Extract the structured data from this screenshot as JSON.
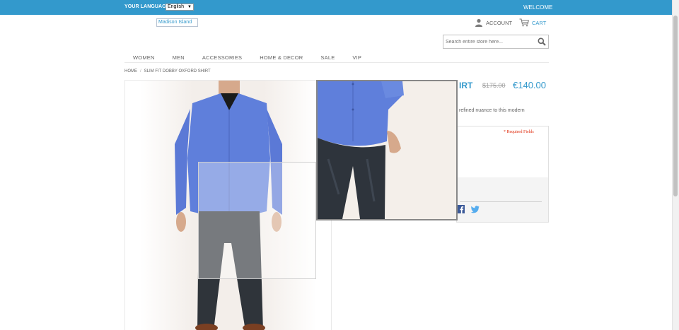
{
  "topbar": {
    "language_label": "YOUR LANGUAGE:",
    "language_selected": "English",
    "welcome": "WELCOME"
  },
  "header": {
    "logo_alt": "Madison Island",
    "account_label": "ACCOUNT",
    "cart_label": "CART",
    "search_placeholder": "Search entire store here..."
  },
  "nav": {
    "items": [
      "WOMEN",
      "MEN",
      "ACCESSORIES",
      "HOME & DECOR",
      "SALE",
      "VIP"
    ]
  },
  "breadcrumb": {
    "home": "HOME",
    "separator": "/",
    "current": "SLIM FIT DOBBY OXFORD SHIRT"
  },
  "product": {
    "name_fragment": "IRT",
    "old_price": "$175.00",
    "price": "€140.00",
    "description_fragment": "refined nuance to this modern",
    "required_fields": "* Required Fields"
  },
  "colors": {
    "accent": "#3399cc",
    "required": "#df280a"
  },
  "icons": {
    "account": "person-icon",
    "cart": "cart-icon",
    "search": "magnifier-icon",
    "facebook": "facebook-icon",
    "twitter": "twitter-icon"
  }
}
